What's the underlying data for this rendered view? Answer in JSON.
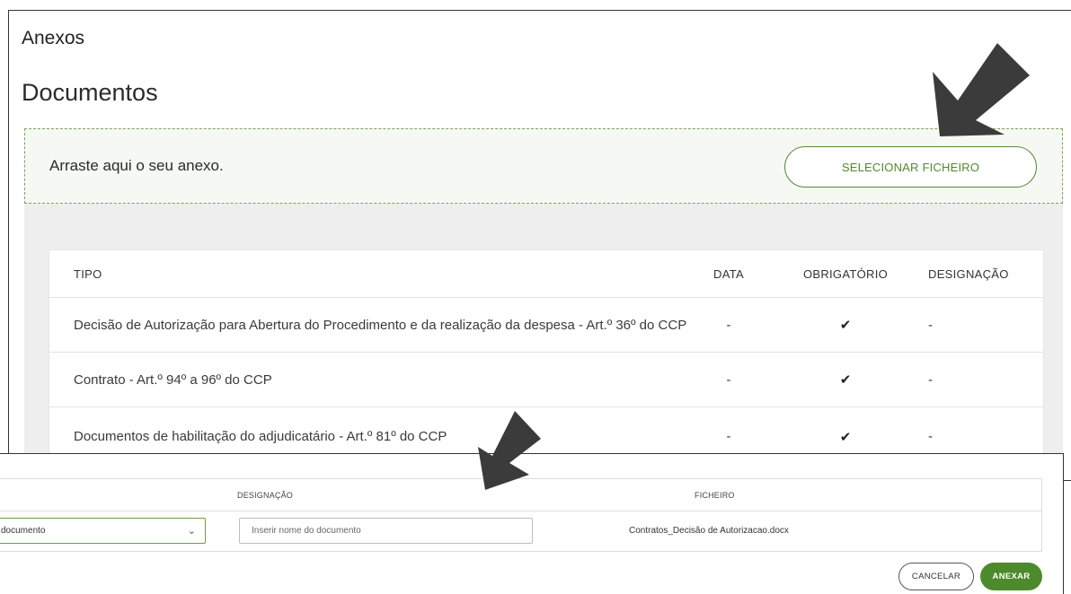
{
  "header": {
    "section_title": "Anexos",
    "page_title": "Documentos"
  },
  "dropzone": {
    "text": "Arraste aqui o seu anexo.",
    "select_button": "SELECIONAR FICHEIRO"
  },
  "documents_table": {
    "columns": [
      "TIPO",
      "DATA",
      "OBRIGATÓRIO",
      "DESIGNAÇÃO"
    ],
    "rows": [
      {
        "tipo": "Decisão de Autorização para Abertura do Procedimento e da realização da despesa - Art.º 36º do CCP",
        "data": "-",
        "obrigatorio": "✔",
        "designacao": "-"
      },
      {
        "tipo": "Contrato - Art.º 94º a 96º do CCP",
        "data": "-",
        "obrigatorio": "✔",
        "designacao": "-"
      },
      {
        "tipo": "Documentos de habilitação do adjudicatário - Art.º 81º do CCP",
        "data": "-",
        "obrigatorio": "✔",
        "designacao": "-"
      }
    ]
  },
  "upload_form": {
    "columns": [
      "DESIGNAÇÃO",
      "FICHEIRO"
    ],
    "type_select_value": "documento",
    "name_placeholder": "Inserir nome do documento",
    "file_name": "Contratos_Decisão de Autorizacao.docx",
    "cancel_button": "CANCELAR",
    "attach_button": "ANEXAR"
  },
  "colors": {
    "accent_green": "#4c8a2c",
    "annotation_arrow": "#3a3a3a"
  },
  "icons": {
    "check": "check-icon",
    "chevron": "chevron-down-icon",
    "arrow": "annotation-arrow-icon"
  }
}
